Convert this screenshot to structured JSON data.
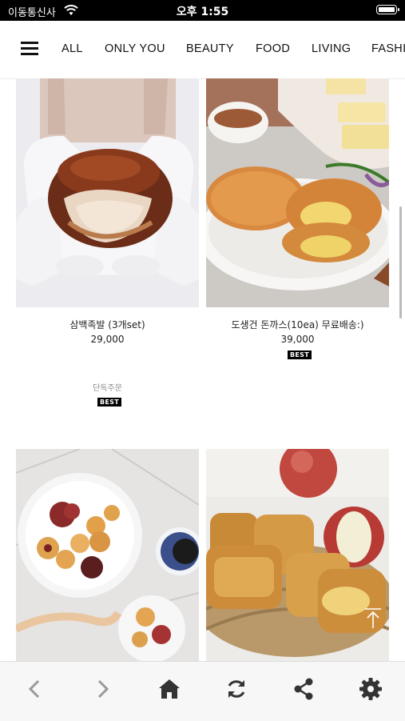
{
  "status": {
    "carrier": "이동통신사",
    "time": "오후 1:55"
  },
  "nav": {
    "tabs": [
      "ALL",
      "ONLY YOU",
      "BEAUTY",
      "FOOD",
      "LIVING",
      "FASHI"
    ]
  },
  "products": [
    {
      "name": "삼백족발 (3개set)",
      "price": "29,000",
      "note": "단독주문",
      "badge": "BEST"
    },
    {
      "name": "도생건 돈까스(10ea) 무료배송:)",
      "price": "39,000",
      "badge": "BEST"
    }
  ],
  "toolbar": {
    "icons": [
      "back-icon",
      "forward-icon",
      "home-icon",
      "refresh-icon",
      "share-icon",
      "settings-icon"
    ]
  },
  "colors": {
    "accent": "#000000",
    "toolbar_icon": "#333333",
    "toolbar_icon_disabled": "#9a9a9a"
  }
}
